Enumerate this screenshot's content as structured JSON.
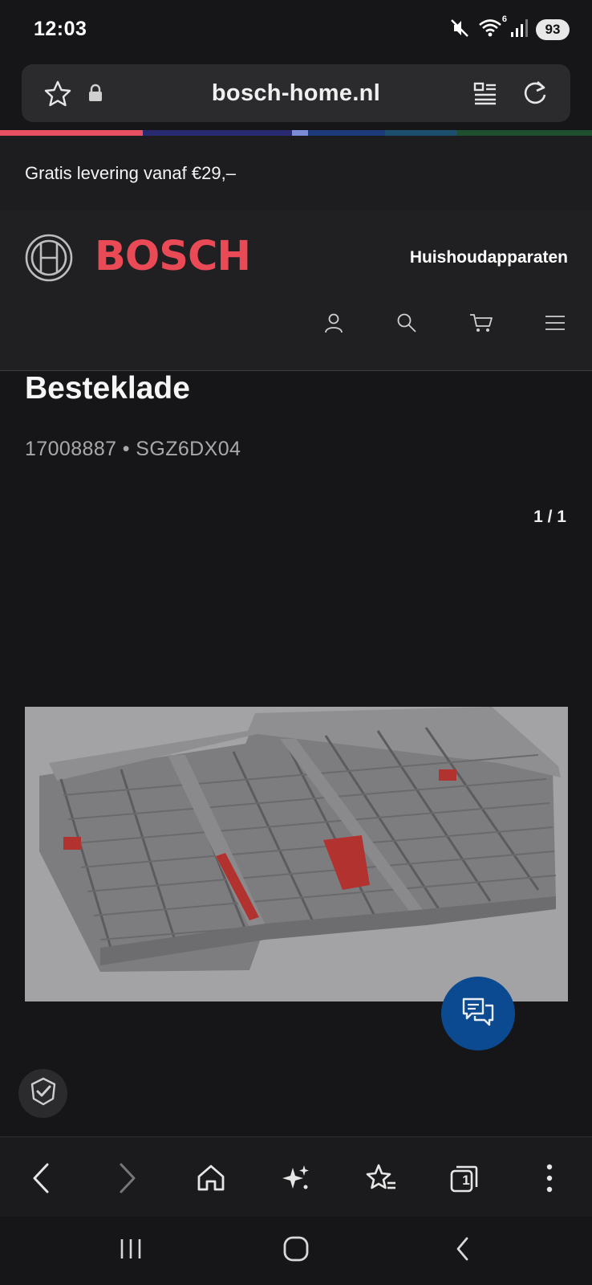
{
  "status_bar": {
    "time": "12:03",
    "battery": "93",
    "wifi_badge": "6",
    "icons": [
      "mute-icon",
      "wifi-icon",
      "signal-icon"
    ]
  },
  "browser": {
    "url": "bosch-home.nl",
    "icons": [
      "star-icon",
      "lock-icon",
      "reader-mode-icon",
      "reload-icon"
    ]
  },
  "promo": {
    "text": "Gratis levering vanaf €29,–"
  },
  "header": {
    "brand": "BOSCH",
    "nav_category": "Huishoudapparaten",
    "icons": [
      "user-icon",
      "search-icon",
      "cart-icon",
      "menu-icon"
    ]
  },
  "product": {
    "title": "Besteklade",
    "subtitle": "17008887 • SGZ6DX04",
    "gallery_counter": "1 / 1",
    "image_alt": "cutlery-tray-image"
  },
  "colors": {
    "brand_red": "#ea4a55",
    "chat_blue": "#0b4a90",
    "background": "#161618",
    "header_bg": "#202023"
  },
  "toolbar": {
    "tabs_count": "1",
    "icons": [
      "back-icon",
      "forward-icon",
      "home-icon",
      "ai-sparkle-icon",
      "bookmarks-icon",
      "tabs-icon",
      "more-icon"
    ]
  },
  "system_nav": {
    "icons": [
      "recents-icon",
      "home-pill-icon",
      "system-back-icon"
    ]
  }
}
